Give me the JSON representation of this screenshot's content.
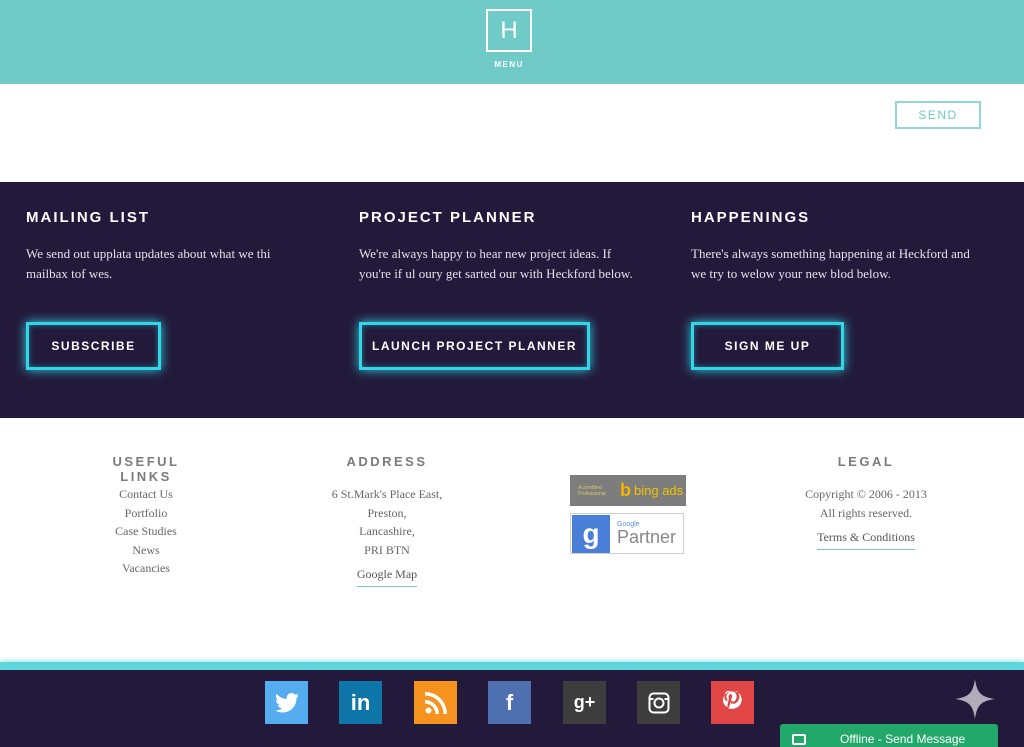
{
  "header": {
    "logo_letter": "H",
    "menu_label": "MENU",
    "bg_color": "#6fcac8"
  },
  "form": {
    "send_label": "SEND"
  },
  "cta": {
    "mailing": {
      "title": "MAILING LIST",
      "text": "We send out upplata updates about what we thi mailbax tof wes.",
      "button": "SUBSCRIBE"
    },
    "planner": {
      "title": "PROJECT PLANNER",
      "text": "We're always happy to hear new project ideas. If you're if ul oury get sarted our with Heckford below.",
      "button": "LAUNCH PROJECT PLANNER"
    },
    "happenings": {
      "title": "HAPPENINGS",
      "text": "There's always something happening at Heckford and we try to welow your new blod below.",
      "button": "SIGN ME UP"
    }
  },
  "footer": {
    "useful": {
      "title": "USEFUL LINKS",
      "links": [
        "Contact Us",
        "Portfolio",
        "Case Studies",
        "News",
        "Vacancies"
      ]
    },
    "address": {
      "title": "ADDRESS",
      "lines": [
        "6 St.Mark's Place East,",
        "Preston,",
        "Lancashire,",
        "PRI BTN"
      ],
      "map_link": "Google Map"
    },
    "badges": {
      "bing_small": "Accredited Professional",
      "bing_text": "bing ads",
      "google_small": "Google",
      "google_text": "Partner"
    },
    "legal": {
      "title": "LEGAL",
      "copyright": "Copyright © 2006 - 2013",
      "rights": "All rights reserved.",
      "terms": "Terms & Conditions"
    }
  },
  "social": {
    "icons": [
      {
        "name": "twitter",
        "glyph": "🐦",
        "color": "#55acee"
      },
      {
        "name": "linkedin",
        "glyph": "in",
        "color": "#0e76a8"
      },
      {
        "name": "rss",
        "glyph": "◉",
        "color": "#f6921e"
      },
      {
        "name": "facebook",
        "glyph": "f",
        "color": "#3b5998"
      },
      {
        "name": "google-plus",
        "glyph": "g+",
        "color": "#3d3d3d"
      },
      {
        "name": "instagram",
        "glyph": "◎",
        "color": "#3d3d3d"
      },
      {
        "name": "pinterest",
        "glyph": "P",
        "color": "#e04646"
      }
    ]
  },
  "chat": {
    "label": "Offline - Send Message"
  }
}
